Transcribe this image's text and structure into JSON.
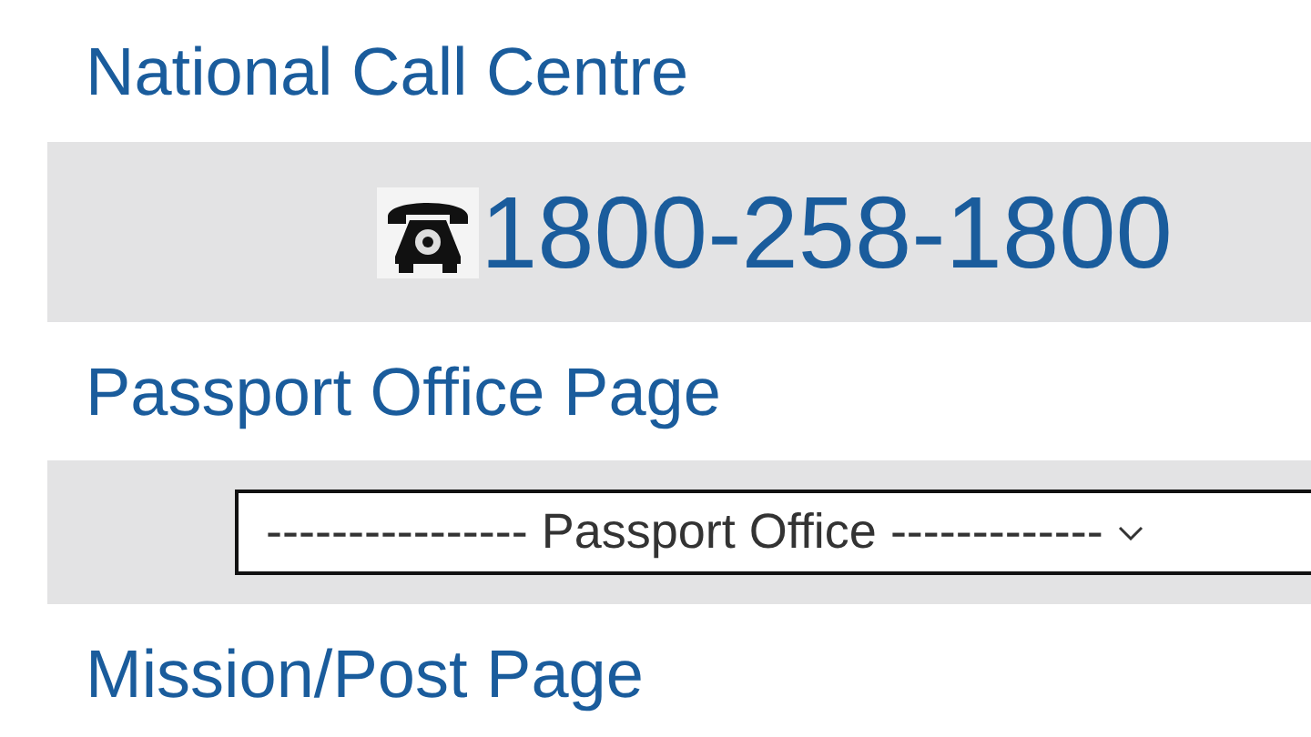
{
  "sections": [
    {
      "kind": "heading",
      "text": "National Call Centre"
    },
    {
      "kind": "phone",
      "number": "1800-258-1800"
    },
    {
      "kind": "heading",
      "text": "Passport Office Page"
    },
    {
      "kind": "select",
      "value": "---------------- Passport Office -------------"
    },
    {
      "kind": "heading",
      "text": "Mission/Post Page"
    }
  ]
}
